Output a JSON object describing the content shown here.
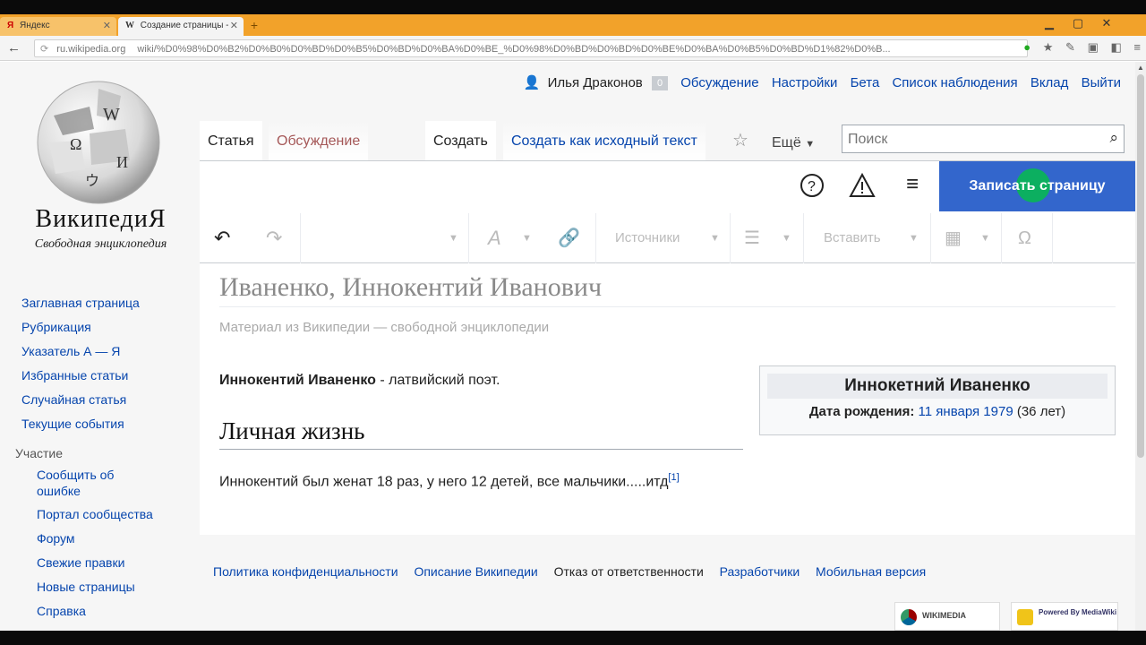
{
  "browser": {
    "tabs": [
      {
        "label": "Яндекс",
        "favicon": "Я"
      },
      {
        "label": "Создание страницы -",
        "favicon": "W"
      }
    ],
    "new_tab_label": "+",
    "url_host": "ru.wikipedia.org",
    "url_path": "wiki/%D0%98%D0%B2%D0%B0%D0%BD%D0%B5%D0%BD%D0%BA%D0%BE_%D0%98%D0%BD%D0%BD%D0%BE%D0%BA%D0%B5%D0%BD%D1%82%D0%B..."
  },
  "logo": {
    "title": "ВикипедиЯ",
    "subtitle": "Свободная энциклопедия"
  },
  "personal": {
    "user": "Илья Драконов",
    "notifications": "0",
    "links": [
      "Обсуждение",
      "Настройки",
      "Бета",
      "Список наблюдения",
      "Вклад",
      "Выйти"
    ]
  },
  "tabs": {
    "article": "Статья",
    "talk": "Обсуждение",
    "create": "Создать",
    "create_source": "Создать как исходный текст",
    "more": "Ещё"
  },
  "search": {
    "placeholder": "Поиск"
  },
  "editor": {
    "save_label": "Записать страницу",
    "references": "Источники",
    "insert": "Вставить",
    "special_chars": "Ω"
  },
  "sidebar": {
    "main": [
      "Заглавная страница",
      "Рубрикация",
      "Указатель А — Я",
      "Избранные статьи",
      "Случайная статья",
      "Текущие события"
    ],
    "participation_heading": "Участие",
    "participation": [
      "Сообщить об ошибке",
      "Портал сообщества",
      "Форум",
      "Свежие правки",
      "Новые страницы",
      "Справка"
    ]
  },
  "article": {
    "title": "Иваненко, Иннокентий Иванович",
    "tagline": "Материал из Википедии — свободной энциклопедии",
    "lead_bold": "Иннокентий Иваненко",
    "lead_rest": " - латвийский поэт.",
    "section_heading": "Личная жизнь",
    "paragraph": "Иннокентий был женат 18 раз, у него 12 детей, все мальчики.....итд",
    "ref": "[1]"
  },
  "infobox": {
    "name": "Иннокетний Иваненко",
    "birth_label": "Дата рождения:",
    "birth_date": "11 января 1979",
    "age": "(36 лет)"
  },
  "footer": {
    "links": [
      "Политика конфиденциальности",
      "Описание Википедии",
      "Отказ от ответственности",
      "Разработчики",
      "Мобильная версия"
    ],
    "wikimedia": "WIKIMEDIA",
    "mediawiki": "Powered By MediaWiki"
  },
  "colors": {
    "link": "#0645ad",
    "save_button": "#3366cc",
    "browser_tabstrip": "#f2a22a"
  }
}
